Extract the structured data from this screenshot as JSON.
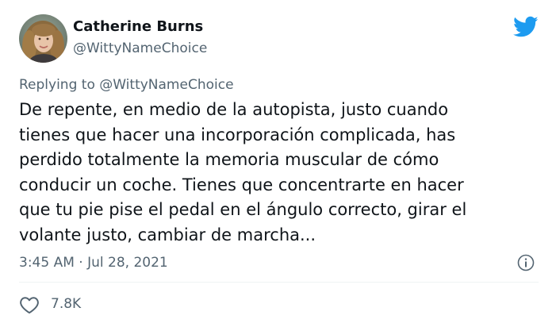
{
  "user": {
    "display_name": "Catherine Burns",
    "handle": "@WittyNameChoice"
  },
  "reply": {
    "prefix": "Replying to ",
    "mention": "@WittyNameChoice"
  },
  "tweet": {
    "lines": [
      "De repente, en medio de la autopista, justo cuando",
      "tienes que hacer una incorporación complicada, has",
      "perdido totalmente la memoria muscular de cómo",
      "conducir un coche. Tienes que concentrarte en hacer",
      "que tu pie pise el pedal en el ángulo correcto, girar el",
      "volante justo, cambiar de marcha..."
    ],
    "timestamp": "3:45 AM · Jul 28, 2021",
    "likes": "7.8K"
  },
  "icons": {
    "logo": "twitter-bird-icon",
    "info": "info-icon",
    "like": "heart-icon"
  },
  "colors": {
    "brand": "#1d9bf0",
    "text": "#0f1419",
    "secondary": "#536471"
  }
}
